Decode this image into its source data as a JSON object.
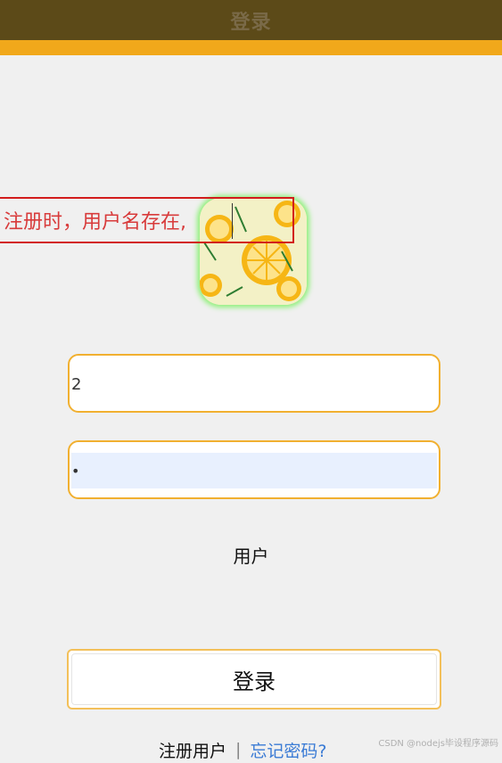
{
  "header": {
    "title": "登录"
  },
  "colors": {
    "header_bg": "#5c4a18",
    "accent": "#f1a81b",
    "field_border": "#f1b030",
    "link": "#3a7bd5",
    "annotation": "#d21c1c"
  },
  "annotation": {
    "text": "注册时，用户名存在,"
  },
  "logo": {
    "icon": "lemon-slices-logo"
  },
  "form": {
    "username_value": "2",
    "password_value": "•",
    "role_label": "用户",
    "login_button": "登录"
  },
  "links": {
    "register": "注册用户",
    "separator": "|",
    "forgot": "忘记密码?"
  },
  "watermark": "CSDN @nodejs毕设程序源码"
}
